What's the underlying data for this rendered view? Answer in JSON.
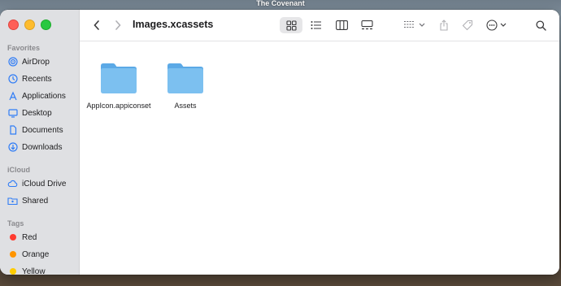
{
  "desktop": {
    "title": "The Covenant"
  },
  "sidebar": {
    "favorites_label": "Favorites",
    "favorites": [
      {
        "label": "AirDrop",
        "icon": "airdrop-icon"
      },
      {
        "label": "Recents",
        "icon": "clock-icon"
      },
      {
        "label": "Applications",
        "icon": "applications-icon"
      },
      {
        "label": "Desktop",
        "icon": "desktop-icon"
      },
      {
        "label": "Documents",
        "icon": "document-icon"
      },
      {
        "label": "Downloads",
        "icon": "download-icon"
      }
    ],
    "icloud_label": "iCloud",
    "icloud": [
      {
        "label": "iCloud Drive",
        "icon": "cloud-icon"
      },
      {
        "label": "Shared",
        "icon": "shared-folder-icon"
      }
    ],
    "tags_label": "Tags",
    "tags": [
      {
        "label": "Red",
        "color": "#ff3b30"
      },
      {
        "label": "Orange",
        "color": "#ff9500"
      },
      {
        "label": "Yellow",
        "color": "#ffcc00"
      }
    ]
  },
  "toolbar": {
    "title": "Images.xcassets",
    "active_view": "icon-view"
  },
  "files": [
    {
      "name": "AppIcon.appiconset"
    },
    {
      "name": "Assets"
    }
  ],
  "colors": {
    "accent": "#2f7cf6",
    "folder": "#7cc0f0"
  }
}
